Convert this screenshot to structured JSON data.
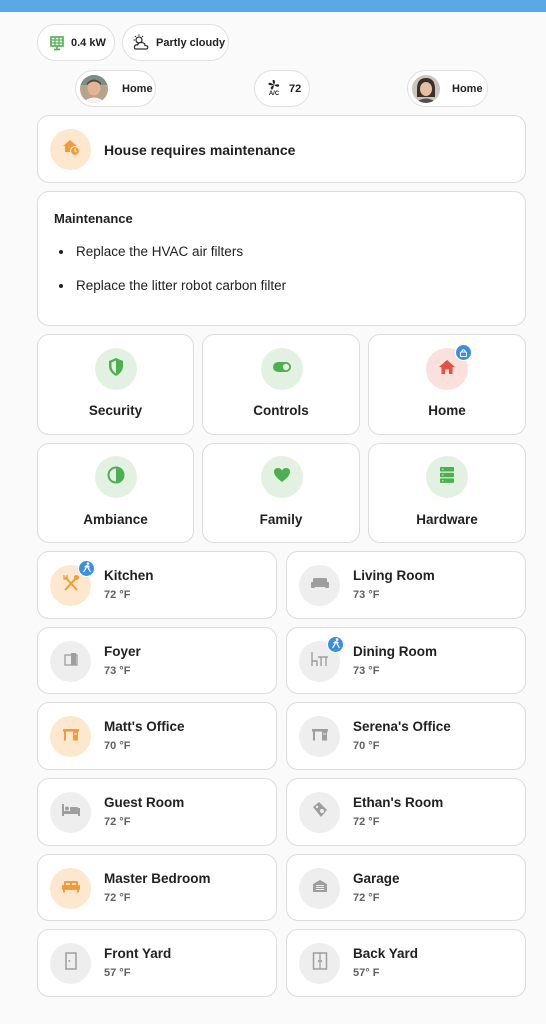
{
  "header": {
    "power_label": "0.4 kW",
    "weather_label": "Partly cloudy",
    "person_left_label": "Home",
    "ac_label": "72",
    "ac_icon_text": "A/C",
    "person_right_label": "Home"
  },
  "alert": {
    "title": "House requires maintenance"
  },
  "maintenance": {
    "title": "Maintenance",
    "items": [
      "Replace the HVAC air filters",
      "Replace the litter robot carbon filter"
    ]
  },
  "nav": [
    {
      "label": "Security",
      "icon": "shield-icon"
    },
    {
      "label": "Controls",
      "icon": "toggle-icon"
    },
    {
      "label": "Home",
      "icon": "house-icon",
      "badge": "lock-icon"
    },
    {
      "label": "Ambiance",
      "icon": "contrast-icon"
    },
    {
      "label": "Family",
      "icon": "heart-icon"
    },
    {
      "label": "Hardware",
      "icon": "server-icon"
    }
  ],
  "rooms": [
    {
      "name": "Kitchen",
      "temp": "72 °F",
      "icon": "utensils-icon",
      "active": true,
      "motion": true
    },
    {
      "name": "Living Room",
      "temp": "73 °F",
      "icon": "sofa-icon",
      "active": false,
      "motion": false
    },
    {
      "name": "Foyer",
      "temp": "73 °F",
      "icon": "door-icon",
      "active": false,
      "motion": false
    },
    {
      "name": "Dining Room",
      "temp": "73 °F",
      "icon": "dining-table-icon",
      "active": false,
      "motion": true
    },
    {
      "name": "Matt's Office",
      "temp": "70 °F",
      "icon": "desk-icon",
      "active": true,
      "motion": false
    },
    {
      "name": "Serena's Office",
      "temp": "70 °F",
      "icon": "desk-icon",
      "active": false,
      "motion": false
    },
    {
      "name": "Guest Room",
      "temp": "72 °F",
      "icon": "bed-icon",
      "active": false,
      "motion": false
    },
    {
      "name": "Ethan's Room",
      "temp": "72 °F",
      "icon": "toy-icon",
      "active": false,
      "motion": false
    },
    {
      "name": "Master Bedroom",
      "temp": "72 °F",
      "icon": "bed-double-icon",
      "active": true,
      "motion": false
    },
    {
      "name": "Garage",
      "temp": "72 °F",
      "icon": "garage-icon",
      "active": false,
      "motion": false
    },
    {
      "name": "Front Yard",
      "temp": "57 °F",
      "icon": "door-closed-icon",
      "active": false,
      "motion": false
    },
    {
      "name": "Back Yard",
      "temp": "57° F",
      "icon": "french-door-icon",
      "active": false,
      "motion": false
    }
  ],
  "colors": {
    "accent_blue": "#3b8fe0",
    "active_orange": "#f29b38",
    "active_bg": "#fde7cf",
    "green": "#4caf50",
    "green_bg": "#e3f1e3",
    "red": "#e15241",
    "red_bg": "#fbe0dd",
    "inactive_icon": "#9e9e9e",
    "inactive_bg": "#eeeeee"
  }
}
